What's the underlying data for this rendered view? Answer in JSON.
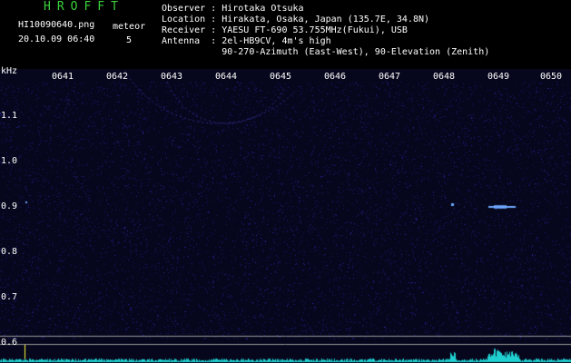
{
  "header": {
    "app_title": "HROFFT",
    "file_name": "HI10090640.png",
    "timestamp": "20.10.09 06:40",
    "meteor_label": "meteor",
    "meteor_count": "5",
    "info_lines": [
      "Observer : Hirotaka Otsuka",
      "Location : Hirakata, Osaka, Japan (135.7E, 34.8N)",
      "Receiver : YAESU FT-690 53.755MHz(Fukui), USB",
      "Antenna  : 2el-HB9CV, 4m's high",
      "           90-270-Azimuth (East-West), 90-Elevation (Zenith)"
    ]
  },
  "axes": {
    "y_unit": "kHz",
    "y_ticks": [
      "1.1",
      "1.0",
      "0.9",
      "0.8",
      "0.7",
      "0.6"
    ],
    "y_values": [
      1.1,
      1.0,
      0.9,
      0.8,
      0.7,
      0.6
    ],
    "x_ticks": [
      "0641",
      "0642",
      "0643",
      "0644",
      "0645",
      "0646",
      "0647",
      "0648",
      "0649",
      "0650"
    ]
  },
  "colors": {
    "background": "#000000",
    "plot_background": "#06061c",
    "noise": "#2a2ad0",
    "signal": "#6fa8ff",
    "guide_line": "#9a9a9a",
    "baseline_trace": "#20d0d0",
    "title_green": "#3bd23b",
    "marker": "#ffff40"
  }
}
